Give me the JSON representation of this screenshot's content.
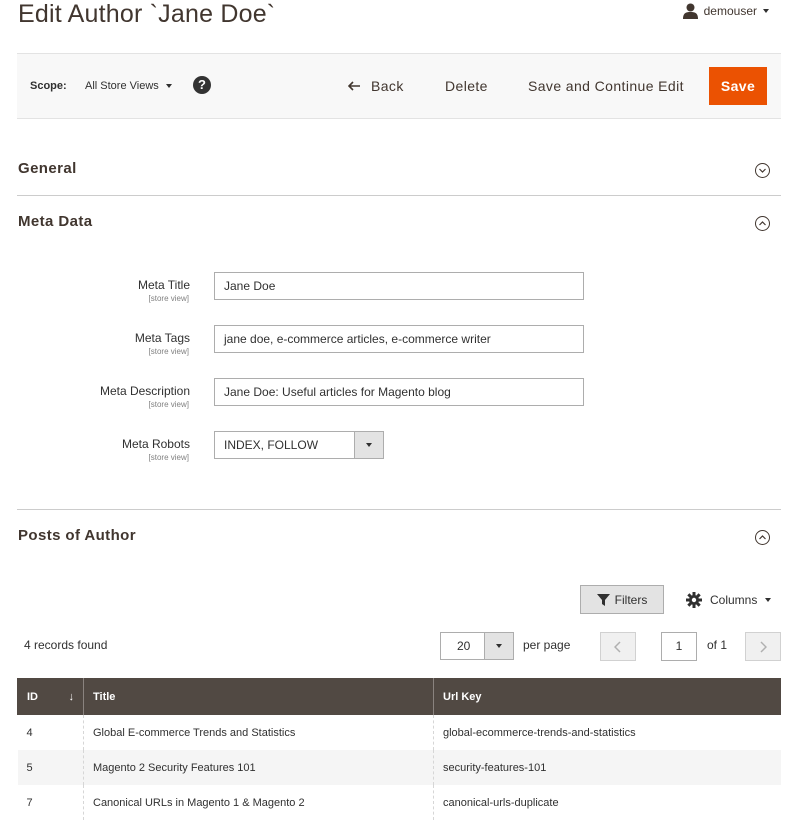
{
  "header": {
    "page_title": "Edit Author `Jane Doe`",
    "user_name": "demouser"
  },
  "toolbar": {
    "scope_label": "Scope:",
    "scope_value": "All Store Views",
    "help_symbol": "?",
    "back_label": "Back",
    "delete_label": "Delete",
    "save_continue_label": "Save and Continue Edit",
    "save_label": "Save"
  },
  "sections": {
    "general": {
      "title": "General",
      "expanded": false
    },
    "meta": {
      "title": "Meta Data",
      "expanded": true
    },
    "posts": {
      "title": "Posts of Author",
      "expanded": true
    }
  },
  "meta_fields": [
    {
      "label": "Meta Title",
      "scope": "[store view]",
      "value": "Jane Doe"
    },
    {
      "label": "Meta Tags",
      "scope": "[store view]",
      "value": "jane doe, e-commerce articles, e-commerce writer"
    },
    {
      "label": "Meta Description",
      "scope": "[store view]",
      "value": "Jane Doe: Useful articles for Magento blog"
    },
    {
      "label": "Meta Robots",
      "scope": "[store view]",
      "value": "INDEX, FOLLOW"
    }
  ],
  "grid_controls": {
    "filters_label": "Filters",
    "columns_label": "Columns",
    "records_found": "4 records found",
    "per_page_value": "20",
    "per_page_label": "per page",
    "current_page": "1",
    "total_pages_label": "of 1"
  },
  "grid": {
    "columns": [
      "ID",
      "Title",
      "Url Key"
    ],
    "sort_indicator": "↓",
    "rows": [
      {
        "id": "4",
        "title": "Global E-commerce Trends and Statistics",
        "url_key": "global-ecommerce-trends-and-statistics"
      },
      {
        "id": "5",
        "title": "Magento 2 Security Features 101",
        "url_key": "security-features-101"
      },
      {
        "id": "7",
        "title": "Canonical URLs in Magento 1 & Magento 2",
        "url_key": "canonical-urls-duplicate"
      }
    ]
  },
  "colors": {
    "accent": "#eb5202",
    "grid_header": "#514943",
    "title_text": "#41362f"
  },
  "icons": {
    "user": "user-icon",
    "back": "arrow-left-icon",
    "help": "question-icon",
    "collapse": "chevron-circle-icon",
    "filter": "funnel-icon",
    "columns": "gear-icon",
    "prev": "chevron-left-icon",
    "next": "chevron-right-icon"
  }
}
